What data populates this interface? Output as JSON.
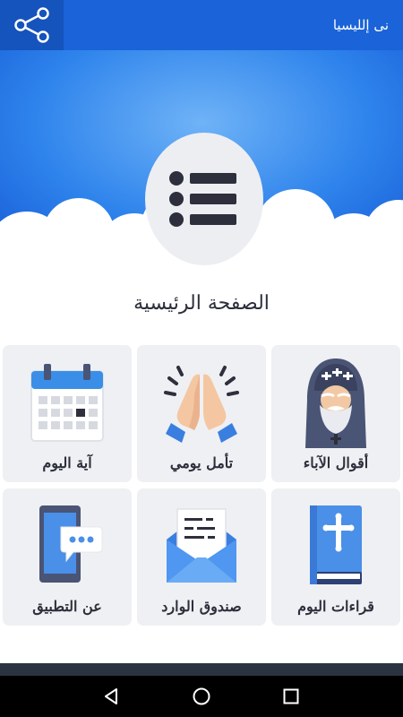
{
  "appbar": {
    "title": "نى إلليسيا",
    "share_icon": "share-icon",
    "color": "#1a63d8"
  },
  "hero": {
    "menu_icon": "list-icon"
  },
  "page": {
    "title": "الصفحة الرئيسية"
  },
  "tiles": [
    {
      "label": "أقوال الآباء",
      "icon": "monk-icon"
    },
    {
      "label": "تأمل يومي",
      "icon": "praying-hands-icon"
    },
    {
      "label": "آية اليوم",
      "icon": "calendar-icon"
    },
    {
      "label": "قراءات اليوم",
      "icon": "bible-icon"
    },
    {
      "label": "صندوق الوارد",
      "icon": "envelope-icon"
    },
    {
      "label": "عن التطبيق",
      "icon": "phone-chat-icon"
    }
  ],
  "navbar": {
    "back_icon": "back-icon",
    "home_icon": "home-icon",
    "recents_icon": "recents-icon"
  }
}
